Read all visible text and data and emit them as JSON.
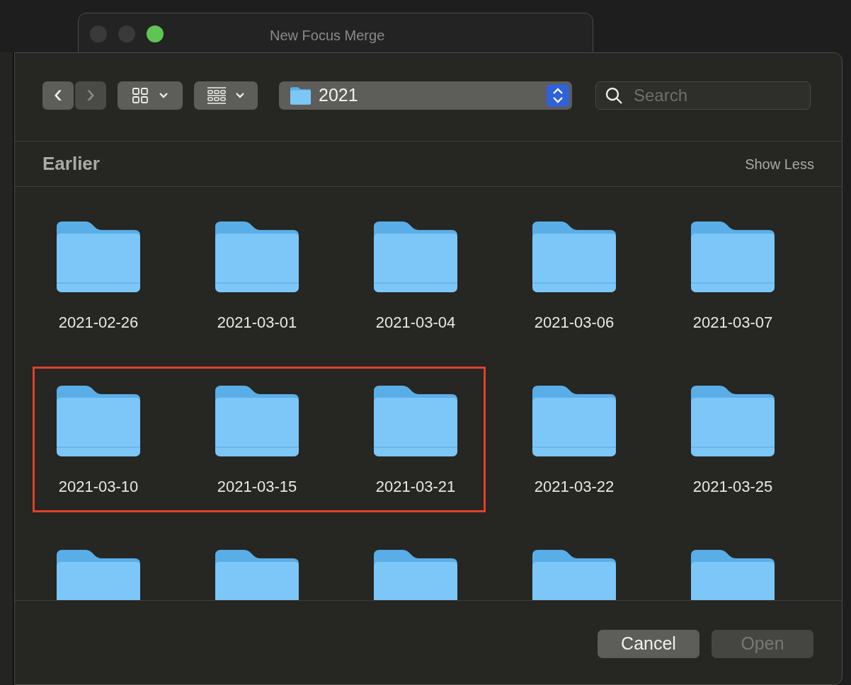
{
  "back_window": {
    "title": "New Focus Merge"
  },
  "toolbar": {
    "back": {
      "label": "‹",
      "disabled": false
    },
    "forward": {
      "label": "›",
      "disabled": true
    },
    "location": "2021",
    "search": {
      "placeholder": "Search"
    }
  },
  "section": {
    "title": "Earlier",
    "action": "Show Less"
  },
  "rows": [
    {
      "items": [
        {
          "kind": "folder",
          "name": "2021-02-26",
          "highlighted": false
        },
        {
          "kind": "folder",
          "name": "2021-03-01",
          "highlighted": false
        },
        {
          "kind": "folder",
          "name": "2021-03-04",
          "highlighted": false
        },
        {
          "kind": "folder",
          "name": "2021-03-06",
          "highlighted": false
        },
        {
          "kind": "folder",
          "name": "2021-03-07",
          "highlighted": false
        }
      ]
    },
    {
      "items": [
        {
          "kind": "folder",
          "name": "2021-03-10",
          "highlighted": true
        },
        {
          "kind": "folder",
          "name": "2021-03-15",
          "highlighted": true
        },
        {
          "kind": "folder",
          "name": "2021-03-21",
          "highlighted": true
        },
        {
          "kind": "folder",
          "name": "2021-03-22",
          "highlighted": false
        },
        {
          "kind": "folder",
          "name": "2021-03-25",
          "highlighted": false
        }
      ]
    },
    {
      "items": [
        {
          "kind": "cut-folder"
        },
        {
          "kind": "cut-folder"
        },
        {
          "kind": "cut-folder"
        },
        {
          "kind": "cut-folder"
        },
        {
          "kind": "cut-folder"
        }
      ]
    }
  ],
  "buttons": [
    {
      "label": "Cancel",
      "disabled": false
    },
    {
      "label": "Open",
      "disabled": true
    }
  ]
}
